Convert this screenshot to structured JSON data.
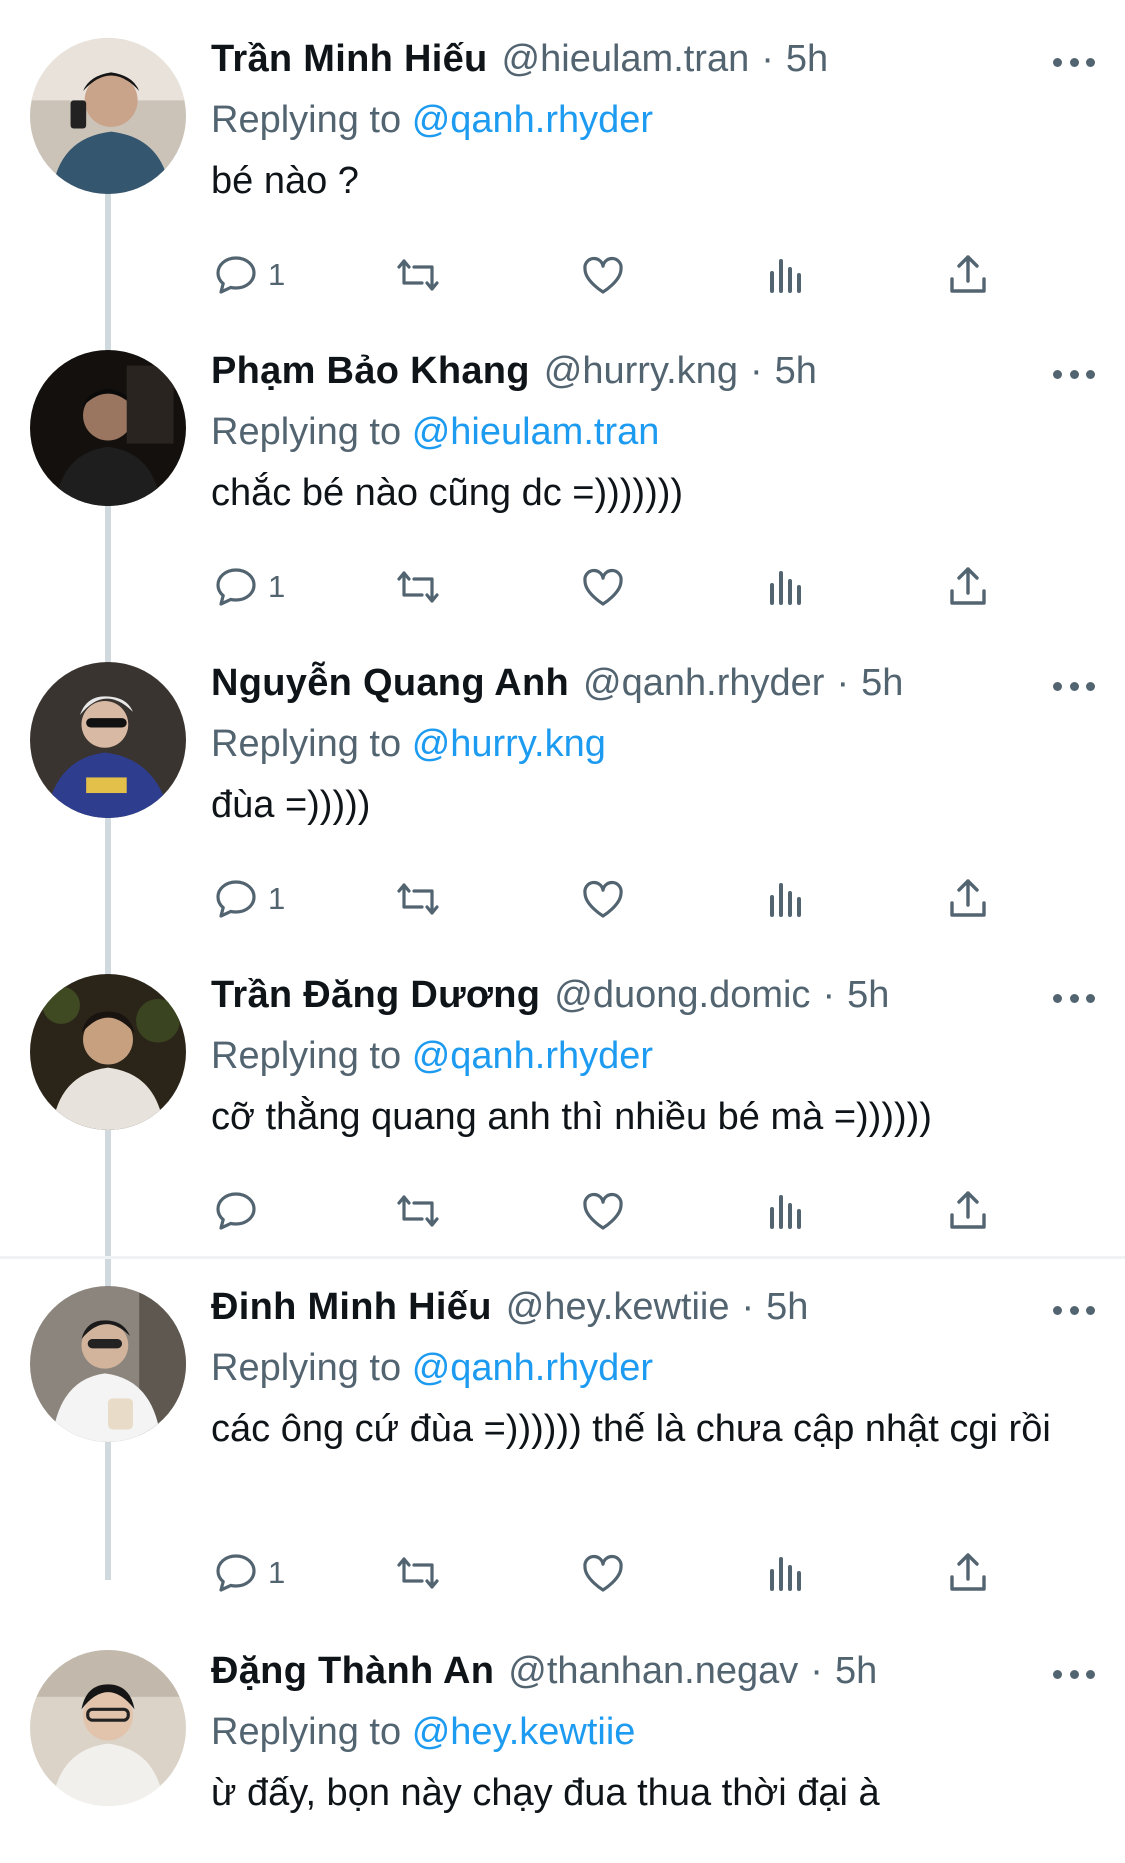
{
  "reply_prefix": "Replying to",
  "tweets": [
    {
      "name": "Trần Minh Hiếu",
      "handle": "@hieulam.tran",
      "dot": "·",
      "time": "5h",
      "reply_to": "@qanh.rhyder",
      "text": "bé nào ?",
      "reply_count": "1",
      "avatar_bg": "#2b3a44"
    },
    {
      "name": "Phạm Bảo Khang",
      "handle": "@hurry.kng",
      "dot": "·",
      "time": "5h",
      "reply_to": "@hieulam.tran",
      "text": "chắc bé nào cũng dc =)))))))",
      "reply_count": "1",
      "avatar_bg": "#1a1512"
    },
    {
      "name": "Nguyễn Quang Anh",
      "handle": "@qanh.rhyder",
      "dot": "·",
      "time": "5h",
      "reply_to": "@hurry.kng",
      "text": "đùa =)))))",
      "reply_count": "1",
      "avatar_bg": "#2e3a7a"
    },
    {
      "name": "Trần Đăng Dương",
      "handle": "@duong.domic",
      "dot": "·",
      "time": "5h",
      "reply_to": "@qanh.rhyder",
      "text": "cỡ thằng quang anh thì nhiều bé mà =))))))",
      "reply_count": "",
      "avatar_bg": "#2a2418"
    },
    {
      "name": "Đinh Minh Hiếu",
      "handle": "@hey.kewtiie",
      "dot": "·",
      "time": "5h",
      "reply_to": "@qanh.rhyder",
      "text": "các ông cứ đùa =)))))) thế là chưa cập nhật cgi rồi",
      "reply_count": "1",
      "avatar_bg": "#6e6a66"
    },
    {
      "name": "Đặng Thành An",
      "handle": "@thanhan.negav",
      "dot": "·",
      "time": "5h",
      "reply_to": "@hey.kewtiie",
      "text": "ừ đấy, bọn này chạy đua thua thời đại à",
      "reply_count": "",
      "avatar_bg": "#d8cfc4"
    }
  ],
  "colors": {
    "accent": "#1d9bf0",
    "secondary_text": "#536471",
    "thread_line": "#cfd9de"
  }
}
